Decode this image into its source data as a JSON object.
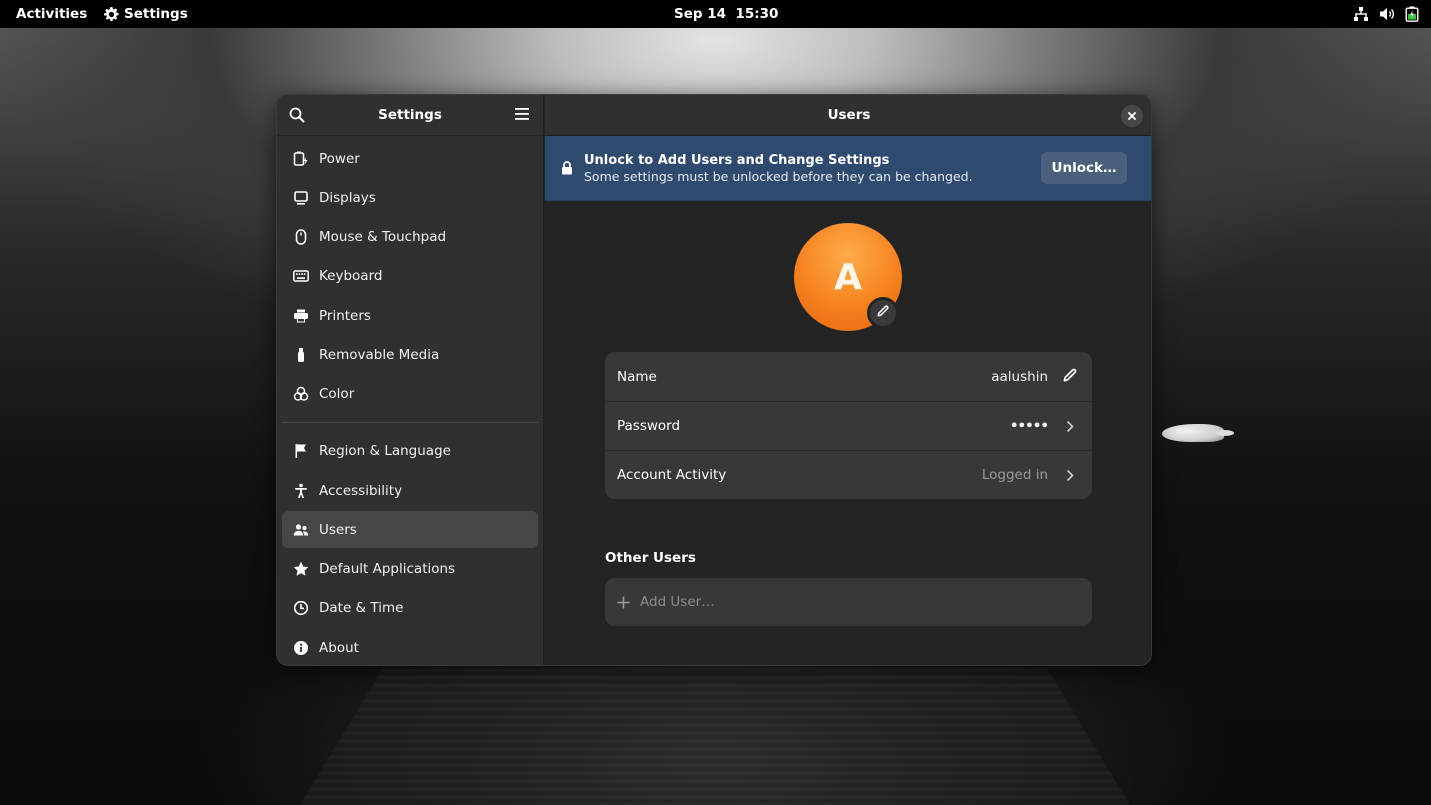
{
  "topbar": {
    "activities": "Activities",
    "app_name": "Settings",
    "clock": "Sep 14  15:30",
    "tray_icons": [
      "network-icon",
      "volume-icon",
      "battery-icon"
    ]
  },
  "window": {
    "sidebar": {
      "title": "Settings",
      "items": [
        {
          "label": "Power",
          "icon": "power-icon"
        },
        {
          "label": "Displays",
          "icon": "display-icon"
        },
        {
          "label": "Mouse & Touchpad",
          "icon": "mouse-icon"
        },
        {
          "label": "Keyboard",
          "icon": "keyboard-icon"
        },
        {
          "label": "Printers",
          "icon": "printer-icon"
        },
        {
          "label": "Removable Media",
          "icon": "usb-icon"
        },
        {
          "label": "Color",
          "icon": "color-icon"
        },
        {
          "label": "Region & Language",
          "icon": "flag-icon"
        },
        {
          "label": "Accessibility",
          "icon": "accessibility-icon"
        },
        {
          "label": "Users",
          "icon": "users-icon",
          "active": true
        },
        {
          "label": "Default Applications",
          "icon": "star-icon"
        },
        {
          "label": "Date & Time",
          "icon": "clock-icon"
        },
        {
          "label": "About",
          "icon": "info-icon"
        }
      ]
    },
    "main": {
      "title": "Users",
      "banner": {
        "heading": "Unlock to Add Users and Change Settings",
        "subtext": "Some settings must be unlocked before they can be changed.",
        "button": "Unlock…"
      },
      "avatar_letter": "A",
      "account": {
        "name_label": "Name",
        "name_value": "aalushin",
        "password_label": "Password",
        "password_value": "•••••",
        "activity_label": "Account Activity",
        "activity_value": "Logged in"
      },
      "other_users": {
        "title": "Other Users",
        "add_user": "Add User…"
      }
    }
  },
  "colors": {
    "accent_avatar": "#f5821f",
    "banner": "#2f4a6f",
    "window_bg": "#242424",
    "sidebar_bg": "#303030"
  }
}
